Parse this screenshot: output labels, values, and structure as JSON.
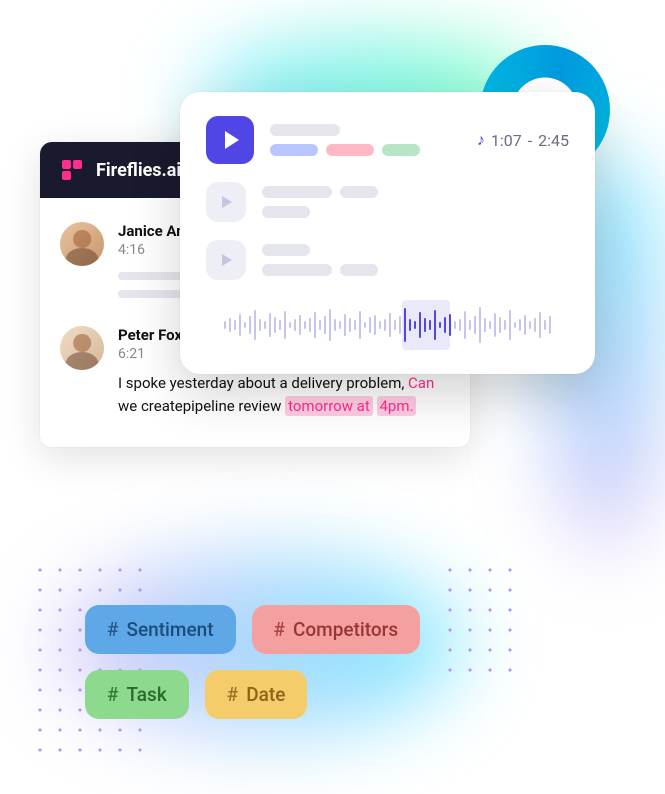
{
  "app": {
    "title": "Fireflies.ai"
  },
  "transcript": {
    "speakers": [
      {
        "name": "Janice Ande",
        "time": "4:16"
      },
      {
        "name": "Peter Fox",
        "time": "6:21",
        "text_pre": "I spoke yesterday about a delivery problem, ",
        "text_can": "Can",
        "text_mid": " we createpipeline review ",
        "text_hl1": "tomorrow at",
        "text_hl2": "4pm."
      }
    ]
  },
  "audio": {
    "time_start": "1:07",
    "time_sep": "-",
    "time_end": "2:45"
  },
  "tags": {
    "sentiment": "Sentiment",
    "competitors": "Competitors",
    "task": "Task",
    "date": "Date"
  }
}
